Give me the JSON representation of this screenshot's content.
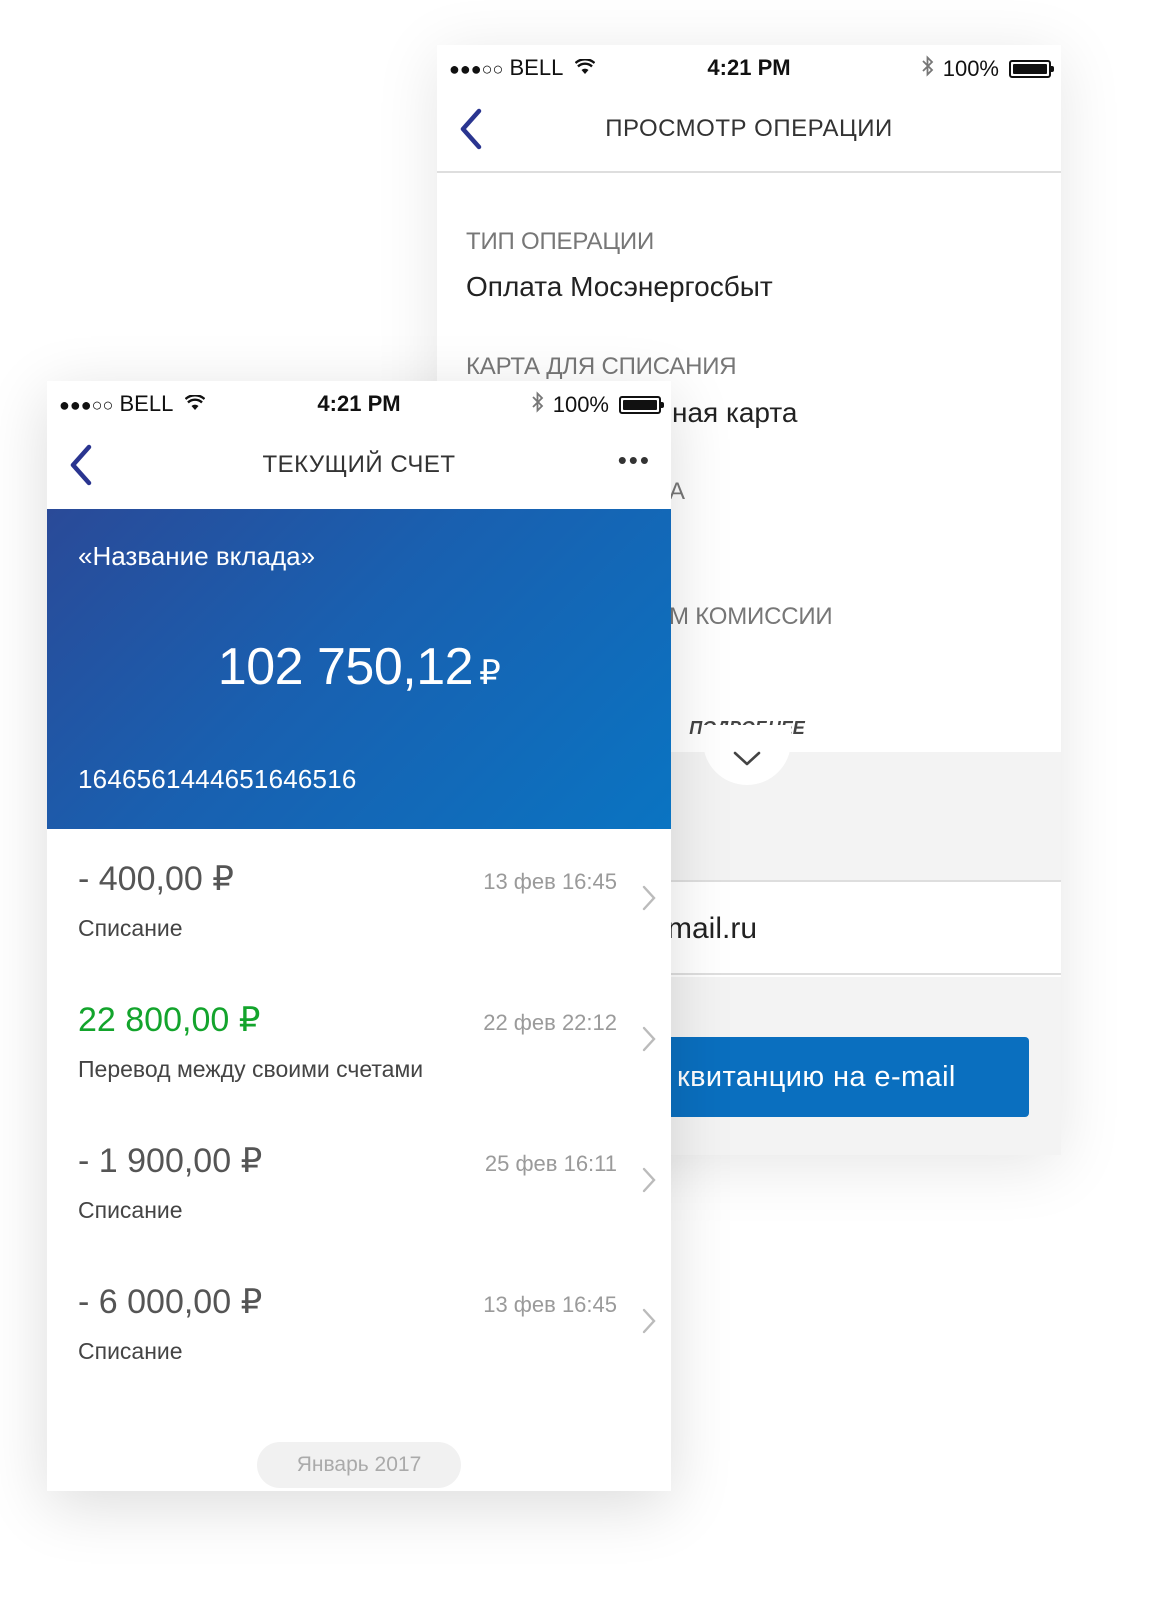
{
  "status_bar": {
    "carrier": "BELL",
    "signal": "●●●○○",
    "time": "4:21 PM",
    "battery": "100%"
  },
  "detail_screen": {
    "title": "ПРОСМОТР ОПЕРАЦИИ",
    "operation_type_label": "ТИП ОПЕРАЦИИ",
    "operation_type_value": "Оплата Мосэнергосбыт",
    "card_label": "КАРТА ДЛЯ СПИСАНИЯ",
    "card_value_visible": "ная карта",
    "partial_label_1": "А",
    "partial_label_2": "М КОМИССИИ",
    "more_label": "ПОДРОБНЕЕ",
    "email_visible": "mail.ru",
    "send_button_visible": "квитанцию на e-mail"
  },
  "account_screen": {
    "title": "ТЕКУЩИЙ СЧЕТ",
    "more_menu": "•••",
    "deposit_name": "«Название вклада»",
    "balance": "102 750,12",
    "currency_sign": "₽",
    "account_number": "1646561444651646516",
    "transactions": [
      {
        "amount": "- 400,00 ₽",
        "date": "13 фев 16:45",
        "description": "Списание",
        "positive": false
      },
      {
        "amount": "22 800,00 ₽",
        "date": "22 фев 22:12",
        "description": "Перевод между своими счетами",
        "positive": true
      },
      {
        "amount": "- 1 900,00 ₽",
        "date": "25 фев 16:11",
        "description": "Списание",
        "positive": false
      },
      {
        "amount": "- 6 000,00 ₽",
        "date": "13 фев 16:45",
        "description": "Списание",
        "positive": false
      }
    ],
    "month_label": "Январь 2017"
  },
  "colors": {
    "accent": "#2a3590",
    "hero_start": "#2a4a98",
    "hero_end": "#0a74c2",
    "positive": "#13a42c",
    "button": "#0a6fbf"
  },
  "icons": {
    "back": "chevron-left-icon",
    "more": "more-dots-icon",
    "row": "chevron-right-icon",
    "expand": "chevron-down-icon"
  }
}
